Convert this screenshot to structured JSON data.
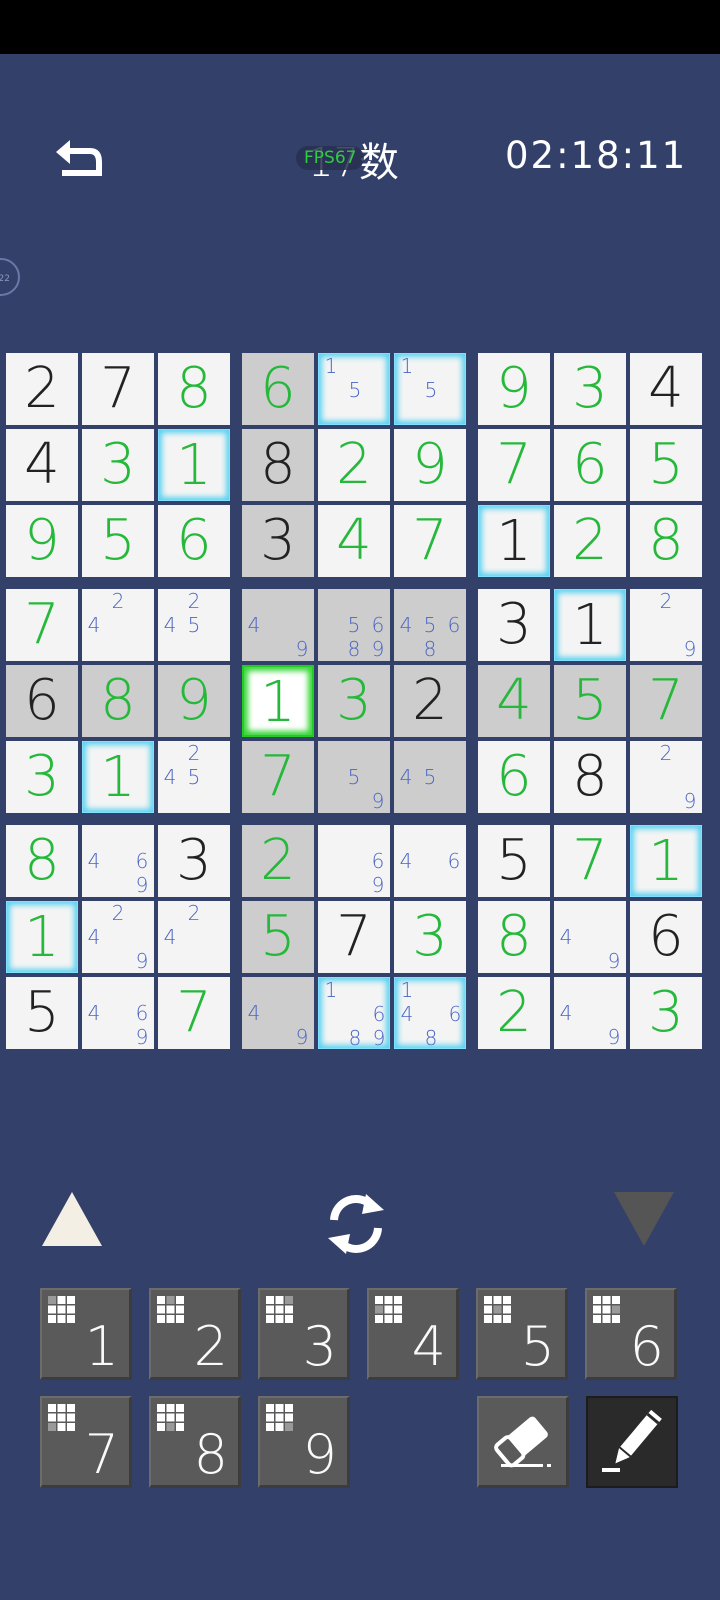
{
  "header": {
    "title": "17数",
    "timer": "02:18:11",
    "fps_label": "FPS67",
    "side_badge": "22"
  },
  "colors": {
    "background": "#33406a",
    "given_digit": "#222222",
    "entered_digit": "#25b83a",
    "note_digit": "#4a65c4",
    "highlight_glow": "#5ad2f0",
    "selected_glow": "#22cc22"
  },
  "board": {
    "rows": [
      [
        {
          "v": "2",
          "t": "given"
        },
        {
          "v": "7",
          "t": "given"
        },
        {
          "v": "8",
          "t": "entered"
        },
        {
          "v": "6",
          "t": "entered",
          "shade": true
        },
        {
          "notes": [
            1,
            5
          ],
          "hl": true
        },
        {
          "notes": [
            1,
            5
          ],
          "hl": true
        },
        {
          "v": "9",
          "t": "entered"
        },
        {
          "v": "3",
          "t": "entered"
        },
        {
          "v": "4",
          "t": "given"
        }
      ],
      [
        {
          "v": "4",
          "t": "given"
        },
        {
          "v": "3",
          "t": "entered"
        },
        {
          "v": "1",
          "t": "entered",
          "hl": true
        },
        {
          "v": "8",
          "t": "given",
          "shade": true
        },
        {
          "v": "2",
          "t": "entered"
        },
        {
          "v": "9",
          "t": "entered"
        },
        {
          "v": "7",
          "t": "entered"
        },
        {
          "v": "6",
          "t": "entered"
        },
        {
          "v": "5",
          "t": "entered"
        }
      ],
      [
        {
          "v": "9",
          "t": "entered"
        },
        {
          "v": "5",
          "t": "entered"
        },
        {
          "v": "6",
          "t": "entered"
        },
        {
          "v": "3",
          "t": "given",
          "shade": true
        },
        {
          "v": "4",
          "t": "entered"
        },
        {
          "v": "7",
          "t": "entered"
        },
        {
          "v": "1",
          "t": "given",
          "hl": true
        },
        {
          "v": "2",
          "t": "entered"
        },
        {
          "v": "8",
          "t": "entered"
        }
      ],
      [
        {
          "v": "7",
          "t": "entered"
        },
        {
          "notes": [
            2,
            4
          ]
        },
        {
          "notes": [
            2,
            4,
            5
          ]
        },
        {
          "notes": [
            4,
            9
          ],
          "shade": true
        },
        {
          "notes": [
            5,
            6,
            8,
            9
          ],
          "shade": true
        },
        {
          "notes": [
            4,
            5,
            6,
            8
          ],
          "shade": true
        },
        {
          "v": "3",
          "t": "given"
        },
        {
          "v": "1",
          "t": "given",
          "hl": true
        },
        {
          "notes": [
            2,
            9
          ]
        }
      ],
      [
        {
          "v": "6",
          "t": "given",
          "shade": true
        },
        {
          "v": "8",
          "t": "entered",
          "shade": true
        },
        {
          "v": "9",
          "t": "entered",
          "shade": true
        },
        {
          "v": "1",
          "t": "entered",
          "sel": true
        },
        {
          "v": "3",
          "t": "entered",
          "shade": true
        },
        {
          "v": "2",
          "t": "given",
          "shade": true
        },
        {
          "v": "4",
          "t": "entered",
          "shade": true
        },
        {
          "v": "5",
          "t": "entered",
          "shade": true
        },
        {
          "v": "7",
          "t": "entered",
          "shade": true
        }
      ],
      [
        {
          "v": "3",
          "t": "entered"
        },
        {
          "v": "1",
          "t": "entered",
          "hl": true
        },
        {
          "notes": [
            2,
            4,
            5
          ]
        },
        {
          "v": "7",
          "t": "entered",
          "shade": true
        },
        {
          "notes": [
            5,
            9
          ],
          "shade": true
        },
        {
          "notes": [
            4,
            5
          ],
          "shade": true
        },
        {
          "v": "6",
          "t": "entered"
        },
        {
          "v": "8",
          "t": "given"
        },
        {
          "notes": [
            2,
            9
          ]
        }
      ],
      [
        {
          "v": "8",
          "t": "entered"
        },
        {
          "notes": [
            4,
            6,
            9
          ]
        },
        {
          "v": "3",
          "t": "given"
        },
        {
          "v": "2",
          "t": "entered",
          "shade": true
        },
        {
          "notes": [
            6,
            9
          ]
        },
        {
          "notes": [
            4,
            6
          ]
        },
        {
          "v": "5",
          "t": "given"
        },
        {
          "v": "7",
          "t": "entered"
        },
        {
          "v": "1",
          "t": "entered",
          "hl": true
        }
      ],
      [
        {
          "v": "1",
          "t": "entered",
          "hl": true
        },
        {
          "notes": [
            2,
            4,
            9
          ]
        },
        {
          "notes": [
            2,
            4
          ]
        },
        {
          "v": "5",
          "t": "entered",
          "shade": true
        },
        {
          "v": "7",
          "t": "given"
        },
        {
          "v": "3",
          "t": "entered"
        },
        {
          "v": "8",
          "t": "entered"
        },
        {
          "notes": [
            4,
            9
          ]
        },
        {
          "v": "6",
          "t": "given"
        }
      ],
      [
        {
          "v": "5",
          "t": "given"
        },
        {
          "notes": [
            4,
            6,
            9
          ]
        },
        {
          "v": "7",
          "t": "entered"
        },
        {
          "notes": [
            4,
            9
          ],
          "shade": true
        },
        {
          "notes": [
            1,
            6,
            8,
            9
          ],
          "hl": true
        },
        {
          "notes": [
            1,
            4,
            6,
            8
          ],
          "hl": true
        },
        {
          "v": "2",
          "t": "entered"
        },
        {
          "notes": [
            4,
            9
          ]
        },
        {
          "v": "3",
          "t": "entered"
        }
      ]
    ]
  },
  "controls": {
    "up_icon": "triangle-up-icon",
    "down_icon": "triangle-down-icon",
    "refresh_icon": "refresh-icon"
  },
  "keypad": {
    "keys": [
      "1",
      "2",
      "3",
      "4",
      "5",
      "6",
      "7",
      "8",
      "9"
    ],
    "eraser_icon": "eraser-icon",
    "pencil_icon": "pencil-icon"
  }
}
